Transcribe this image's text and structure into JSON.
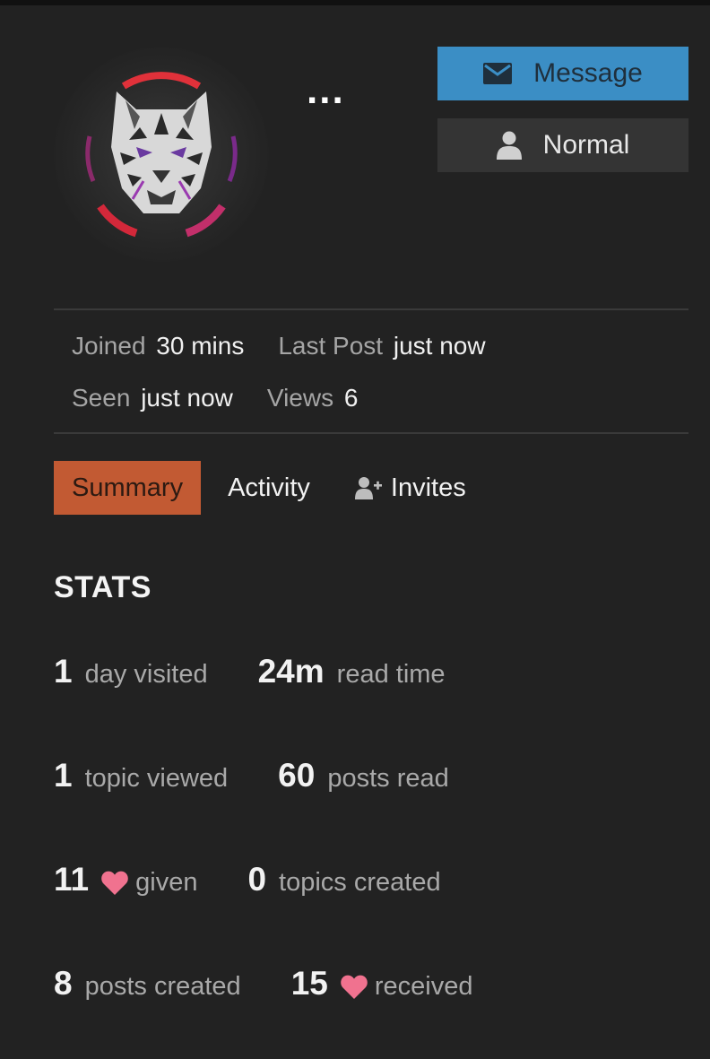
{
  "profile": {
    "username": "...",
    "message_button": "Message",
    "trust_button": "Normal"
  },
  "meta": {
    "joined_label": "Joined",
    "joined_value": "30 mins",
    "last_post_label": "Last Post",
    "last_post_value": "just now",
    "seen_label": "Seen",
    "seen_value": "just now",
    "views_label": "Views",
    "views_value": "6"
  },
  "tabs": [
    {
      "label": "Summary",
      "active": true
    },
    {
      "label": "Activity",
      "active": false
    },
    {
      "label": "Invites",
      "active": false
    }
  ],
  "stats": {
    "title": "STATS",
    "days_visited": {
      "value": "1",
      "label": "day visited"
    },
    "read_time": {
      "value": "24m",
      "label": "read time"
    },
    "topics_viewed": {
      "value": "1",
      "label": "topic viewed"
    },
    "posts_read": {
      "value": "60",
      "label": "posts read"
    },
    "likes_given": {
      "value": "11",
      "label": "given"
    },
    "topics_created": {
      "value": "0",
      "label": "topics created"
    },
    "posts_created": {
      "value": "8",
      "label": "posts created"
    },
    "likes_received": {
      "value": "15",
      "label": "received"
    }
  },
  "icons": {
    "message": "envelope-icon",
    "trust": "user-icon",
    "invites": "user-plus-icon",
    "like": "heart-icon"
  },
  "colors": {
    "background": "#222222",
    "message_button": "#3b8ec5",
    "active_tab": "#c25a33",
    "heart": "#f0728f"
  }
}
